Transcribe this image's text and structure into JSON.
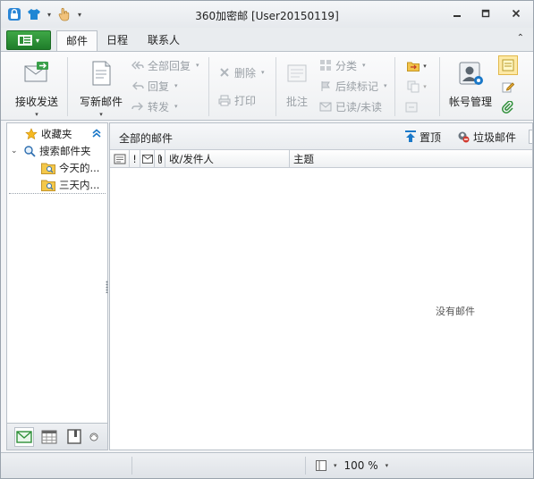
{
  "window": {
    "title": "360加密邮 [User20150119]"
  },
  "ribbon_tabs": [
    {
      "label": "邮件",
      "active": true
    },
    {
      "label": "日程",
      "active": false
    },
    {
      "label": "联系人",
      "active": false
    }
  ],
  "ribbon": {
    "receive_send": "接收发送",
    "compose": "写新邮件",
    "reply_all": "全部回复",
    "reply": "回复",
    "forward": "转发",
    "delete": "删除",
    "print": "打印",
    "annotate": "批注",
    "categorize": "分类",
    "followup": "后续标记",
    "read_unread": "已读/未读",
    "account_manage": "帐号管理"
  },
  "sidebar": {
    "favorites": "收藏夹",
    "search_folder": "搜索邮件夹",
    "items": [
      {
        "label": "今天的..."
      },
      {
        "label": "三天内..."
      }
    ]
  },
  "maillist": {
    "title": "全部的邮件",
    "pin_label": "置顶",
    "junk_label": "垃圾邮件",
    "columns": {
      "flag": "!",
      "from": "收/发件人",
      "subject": "主题"
    },
    "empty_text": "没有邮件"
  },
  "statusbar": {
    "zoom": "100 %"
  },
  "colors": {
    "accent_green": "#2e8f38",
    "icon_blue": "#1a78c8"
  }
}
